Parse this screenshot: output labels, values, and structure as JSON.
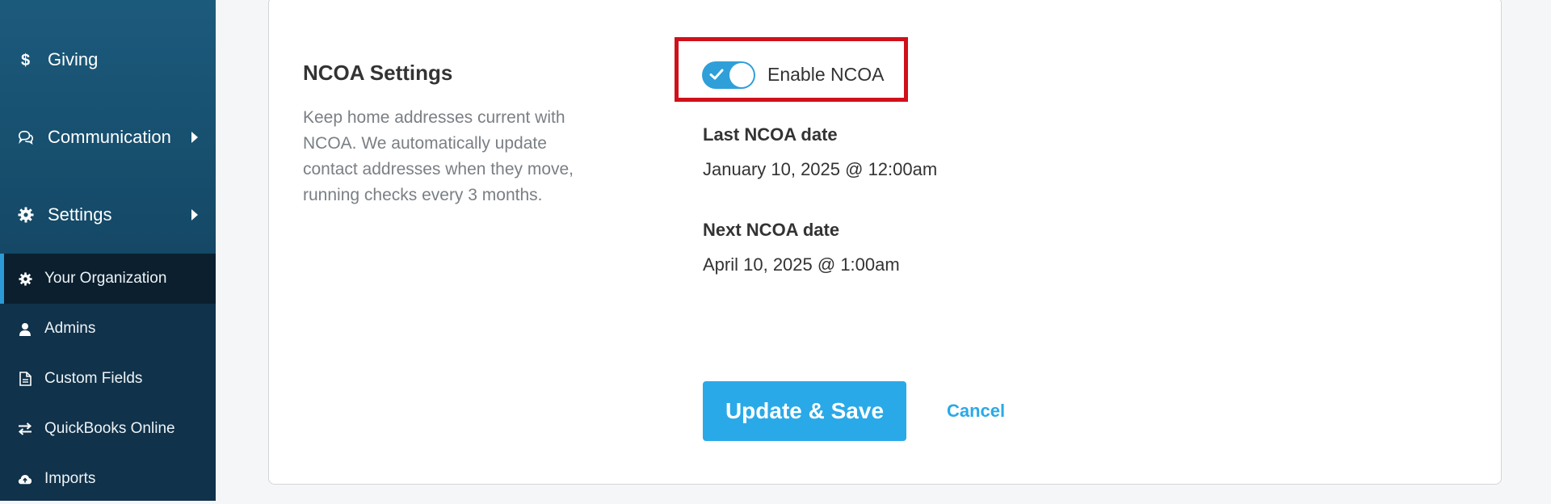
{
  "sidebar": {
    "main_items": [
      {
        "label": "Giving",
        "icon": "dollar-icon"
      },
      {
        "label": "Communication",
        "icon": "chat-icon"
      },
      {
        "label": "Settings",
        "icon": "gear-icon"
      }
    ],
    "sub_items": [
      {
        "label": "Your Organization",
        "icon": "gear-icon",
        "active": true
      },
      {
        "label": "Admins",
        "icon": "user-icon"
      },
      {
        "label": "Custom Fields",
        "icon": "document-icon"
      },
      {
        "label": "QuickBooks Online",
        "icon": "swap-arrows-icon"
      },
      {
        "label": "Imports",
        "icon": "cloud-upload-icon"
      }
    ]
  },
  "ncoa": {
    "title": "NCOA Settings",
    "description": "Keep home addresses current with NCOA. We automatically update contact addresses when they move, running checks every 3 months.",
    "toggle_label": "Enable NCOA",
    "toggle_on": true,
    "last_label": "Last NCOA date",
    "last_value": "January 10, 2025 @ 12:00am",
    "next_label": "Next NCOA date",
    "next_value": "April 10, 2025 @ 1:00am"
  },
  "actions": {
    "save_label": "Update & Save",
    "cancel_label": "Cancel"
  },
  "colors": {
    "accent": "#2aa9e8",
    "highlight": "#d0101a",
    "sidebar": "#154a68"
  }
}
